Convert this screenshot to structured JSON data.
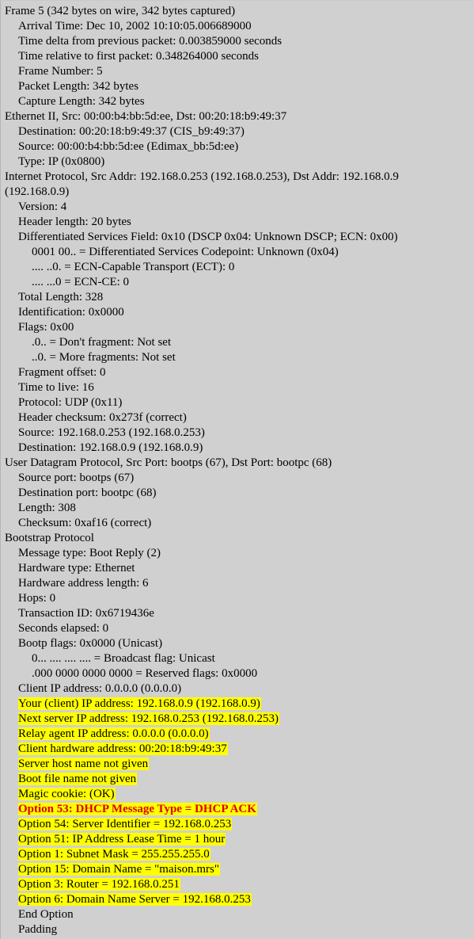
{
  "pane": {
    "name": "packet-details-tree",
    "background_color": "#d0d0d0",
    "highlight_color": "#ffff00",
    "highlight_text_color": "#dd0000"
  },
  "rows": [
    {
      "level": 0,
      "text": "Frame 5 (342 bytes on wire, 342 bytes captured)",
      "highlight": false,
      "emphasis": false
    },
    {
      "level": 1,
      "text": "Arrival Time: Dec 10, 2002 10:10:05.006689000",
      "highlight": false,
      "emphasis": false
    },
    {
      "level": 1,
      "text": "Time delta from previous packet: 0.003859000 seconds",
      "highlight": false,
      "emphasis": false
    },
    {
      "level": 1,
      "text": "Time relative to first packet: 0.348264000 seconds",
      "highlight": false,
      "emphasis": false
    },
    {
      "level": 1,
      "text": "Frame Number: 5",
      "highlight": false,
      "emphasis": false
    },
    {
      "level": 1,
      "text": "Packet Length: 342 bytes",
      "highlight": false,
      "emphasis": false
    },
    {
      "level": 1,
      "text": "Capture Length: 342 bytes",
      "highlight": false,
      "emphasis": false
    },
    {
      "level": 0,
      "text": "Ethernet II, Src: 00:00:b4:bb:5d:ee, Dst: 00:20:18:b9:49:37",
      "highlight": false,
      "emphasis": false
    },
    {
      "level": 1,
      "text": "Destination: 00:20:18:b9:49:37 (CIS_b9:49:37)",
      "highlight": false,
      "emphasis": false
    },
    {
      "level": 1,
      "text": "Source: 00:00:b4:bb:5d:ee (Edimax_bb:5d:ee)",
      "highlight": false,
      "emphasis": false
    },
    {
      "level": 1,
      "text": "Type: IP (0x0800)",
      "highlight": false,
      "emphasis": false
    },
    {
      "level": 0,
      "text": "Internet Protocol, Src Addr: 192.168.0.253 (192.168.0.253), Dst Addr: 192.168.0.9",
      "highlight": false,
      "emphasis": false
    },
    {
      "level": 0,
      "text": "(192.168.0.9)",
      "highlight": false,
      "emphasis": false
    },
    {
      "level": 1,
      "text": "Version: 4",
      "highlight": false,
      "emphasis": false
    },
    {
      "level": 1,
      "text": "Header length: 20 bytes",
      "highlight": false,
      "emphasis": false
    },
    {
      "level": 1,
      "text": "Differentiated Services Field: 0x10 (DSCP 0x04: Unknown DSCP; ECN: 0x00)",
      "highlight": false,
      "emphasis": false
    },
    {
      "level": 2,
      "text": "0001 00.. = Differentiated Services Codepoint: Unknown (0x04)",
      "highlight": false,
      "emphasis": false
    },
    {
      "level": 2,
      "text": ".... ..0. = ECN-Capable Transport (ECT): 0",
      "highlight": false,
      "emphasis": false
    },
    {
      "level": 2,
      "text": ".... ...0 = ECN-CE: 0",
      "highlight": false,
      "emphasis": false
    },
    {
      "level": 1,
      "text": "Total Length: 328",
      "highlight": false,
      "emphasis": false
    },
    {
      "level": 1,
      "text": "Identification: 0x0000",
      "highlight": false,
      "emphasis": false
    },
    {
      "level": 1,
      "text": "Flags: 0x00",
      "highlight": false,
      "emphasis": false
    },
    {
      "level": 2,
      "text": ".0.. = Don't fragment: Not set",
      "highlight": false,
      "emphasis": false
    },
    {
      "level": 2,
      "text": "..0. = More fragments: Not set",
      "highlight": false,
      "emphasis": false
    },
    {
      "level": 1,
      "text": "Fragment offset: 0",
      "highlight": false,
      "emphasis": false
    },
    {
      "level": 1,
      "text": "Time to live: 16",
      "highlight": false,
      "emphasis": false
    },
    {
      "level": 1,
      "text": "Protocol: UDP (0x11)",
      "highlight": false,
      "emphasis": false
    },
    {
      "level": 1,
      "text": "Header checksum: 0x273f (correct)",
      "highlight": false,
      "emphasis": false
    },
    {
      "level": 1,
      "text": "Source: 192.168.0.253 (192.168.0.253)",
      "highlight": false,
      "emphasis": false
    },
    {
      "level": 1,
      "text": "Destination: 192.168.0.9 (192.168.0.9)",
      "highlight": false,
      "emphasis": false
    },
    {
      "level": 0,
      "text": "User Datagram Protocol, Src Port: bootps (67), Dst Port: bootpc (68)",
      "highlight": false,
      "emphasis": false
    },
    {
      "level": 1,
      "text": "Source port: bootps (67)",
      "highlight": false,
      "emphasis": false
    },
    {
      "level": 1,
      "text": "Destination port: bootpc (68)",
      "highlight": false,
      "emphasis": false
    },
    {
      "level": 1,
      "text": "Length: 308",
      "highlight": false,
      "emphasis": false
    },
    {
      "level": 1,
      "text": "Checksum: 0xaf16 (correct)",
      "highlight": false,
      "emphasis": false
    },
    {
      "level": 0,
      "text": "Bootstrap Protocol",
      "highlight": false,
      "emphasis": false
    },
    {
      "level": 1,
      "text": "Message type: Boot Reply (2)",
      "highlight": false,
      "emphasis": false
    },
    {
      "level": 1,
      "text": "Hardware type: Ethernet",
      "highlight": false,
      "emphasis": false
    },
    {
      "level": 1,
      "text": "Hardware address length: 6",
      "highlight": false,
      "emphasis": false
    },
    {
      "level": 1,
      "text": "Hops: 0",
      "highlight": false,
      "emphasis": false
    },
    {
      "level": 1,
      "text": "Transaction ID: 0x6719436e",
      "highlight": false,
      "emphasis": false
    },
    {
      "level": 1,
      "text": "Seconds elapsed: 0",
      "highlight": false,
      "emphasis": false
    },
    {
      "level": 1,
      "text": "Bootp flags: 0x0000 (Unicast)",
      "highlight": false,
      "emphasis": false
    },
    {
      "level": 2,
      "text": "0... .... .... .... = Broadcast flag: Unicast",
      "highlight": false,
      "emphasis": false
    },
    {
      "level": 2,
      "text": ".000 0000 0000 0000 = Reserved flags: 0x0000",
      "highlight": false,
      "emphasis": false
    },
    {
      "level": 1,
      "text": "Client IP address: 0.0.0.0 (0.0.0.0)",
      "highlight": false,
      "emphasis": false
    },
    {
      "level": 1,
      "text": "Your (client) IP address: 192.168.0.9 (192.168.0.9)",
      "highlight": true,
      "emphasis": false
    },
    {
      "level": 1,
      "text": "Next server IP address: 192.168.0.253 (192.168.0.253)",
      "highlight": true,
      "emphasis": false
    },
    {
      "level": 1,
      "text": "Relay agent IP address: 0.0.0.0 (0.0.0.0)",
      "highlight": true,
      "emphasis": false
    },
    {
      "level": 1,
      "text": "Client hardware address: 00:20:18:b9:49:37",
      "highlight": true,
      "emphasis": false
    },
    {
      "level": 1,
      "text": "Server host name not given",
      "highlight": true,
      "emphasis": false
    },
    {
      "level": 1,
      "text": "Boot file name not given",
      "highlight": true,
      "emphasis": false
    },
    {
      "level": 1,
      "text": "Magic cookie: (OK)",
      "highlight": true,
      "emphasis": false
    },
    {
      "level": 1,
      "text": "Option 53: DHCP Message Type = DHCP ACK",
      "highlight": true,
      "emphasis": true
    },
    {
      "level": 1,
      "text": "Option 54: Server Identifier = 192.168.0.253",
      "highlight": true,
      "emphasis": false
    },
    {
      "level": 1,
      "text": "Option 51: IP Address Lease Time = 1 hour",
      "highlight": true,
      "emphasis": false
    },
    {
      "level": 1,
      "text": "Option 1: Subnet Mask = 255.255.255.0",
      "highlight": true,
      "emphasis": false
    },
    {
      "level": 1,
      "text": "Option 15: Domain Name = \"maison.mrs\"",
      "highlight": true,
      "emphasis": false
    },
    {
      "level": 1,
      "text": "Option 3: Router = 192.168.0.251",
      "highlight": true,
      "emphasis": false
    },
    {
      "level": 1,
      "text": "Option 6: Domain Name Server = 192.168.0.253",
      "highlight": true,
      "emphasis": false
    },
    {
      "level": 1,
      "text": "End Option",
      "highlight": false,
      "emphasis": false
    },
    {
      "level": 1,
      "text": "Padding",
      "highlight": false,
      "emphasis": false
    }
  ]
}
